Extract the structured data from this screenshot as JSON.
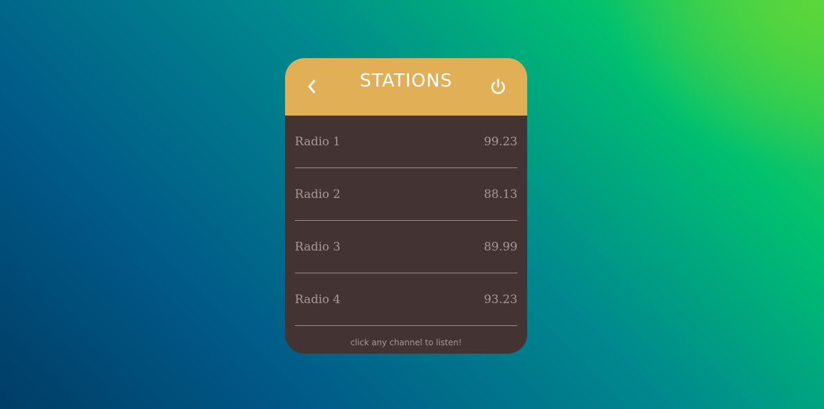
{
  "header": {
    "title": "STATIONS",
    "back_icon": "chevron-left-icon",
    "power_icon": "power-icon"
  },
  "stations": [
    {
      "name": "Radio 1",
      "frequency": "99.23"
    },
    {
      "name": "Radio 2",
      "frequency": "88.13"
    },
    {
      "name": "Radio 3",
      "frequency": "89.99"
    },
    {
      "name": "Radio 4",
      "frequency": "93.23"
    }
  ],
  "footer": {
    "hint": "click any channel to listen!"
  },
  "colors": {
    "header_bg": "#e1af55",
    "card_bg": "#433332",
    "text_muted": "#a8999a",
    "header_text": "#ffffff"
  }
}
